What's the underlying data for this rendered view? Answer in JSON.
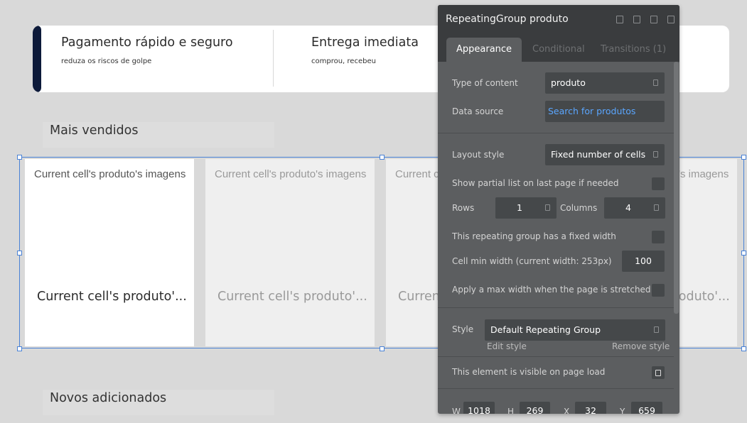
{
  "banner": {
    "feature1": {
      "title": "Pagamento rápido e seguro",
      "subtitle": "reduza os riscos de golpe"
    },
    "feature2": {
      "title": "Entrega imediata",
      "subtitle": "comprou, recebeu"
    }
  },
  "sections": {
    "best_sellers": "Mais vendidos",
    "new_arrivals": "Novos adicionados"
  },
  "repeating_group": {
    "cells": [
      {
        "image_text": "Current cell's produto's imagens",
        "name_text": "Current cell's produto'..."
      },
      {
        "image_text": "Current cell's produto's imagens",
        "name_text": "Current cell's produto'..."
      },
      {
        "image_text": "Current cell's produto's imagens",
        "name_text": "Current cell's produto'..."
      },
      {
        "image_text": "Current cell's produto's imagens",
        "name_text": "Current cell's produto'..."
      }
    ]
  },
  "palette": {
    "title": "RepeatingGroup produto",
    "header_icons": [
      "help-icon",
      "comment-icon",
      "lock-icon",
      "close-icon"
    ],
    "tabs": [
      {
        "label": "Appearance",
        "active": true
      },
      {
        "label": "Conditional",
        "active": false
      },
      {
        "label": "Transitions (1)",
        "active": false
      }
    ],
    "type_of_content": {
      "label": "Type of content",
      "value": "produto"
    },
    "data_source": {
      "label": "Data source",
      "value": "Search for produtos"
    },
    "layout_style": {
      "label": "Layout style",
      "value": "Fixed number of cells"
    },
    "show_partial": {
      "label": "Show partial list on last page if needed",
      "checked": false
    },
    "rows": {
      "label": "Rows",
      "value": "1"
    },
    "columns": {
      "label": "Columns",
      "value": "4"
    },
    "fixed_width": {
      "label": "This repeating group has a fixed width",
      "checked": false
    },
    "cell_min_width": {
      "label": "Cell min width (current width: 253px)",
      "value": "100"
    },
    "max_width": {
      "label": "Apply a max width when the page is stretched",
      "checked": false
    },
    "style": {
      "label": "Style",
      "value": "Default Repeating Group",
      "edit": "Edit style",
      "remove": "Remove style"
    },
    "visible": {
      "label": "This element is visible on page load",
      "checked": true
    },
    "coords": {
      "w_label": "W",
      "w": "1018",
      "h_label": "H",
      "h": "269",
      "x_label": "X",
      "x": "32",
      "y_label": "Y",
      "y": "659"
    }
  },
  "colors": {
    "selection_blue": "#4a82d6",
    "banner_accent": "#0d1a3a",
    "palette_bg": "#5c5e60",
    "palette_header": "#3a3c3e",
    "link_blue": "#5aa6ff"
  }
}
